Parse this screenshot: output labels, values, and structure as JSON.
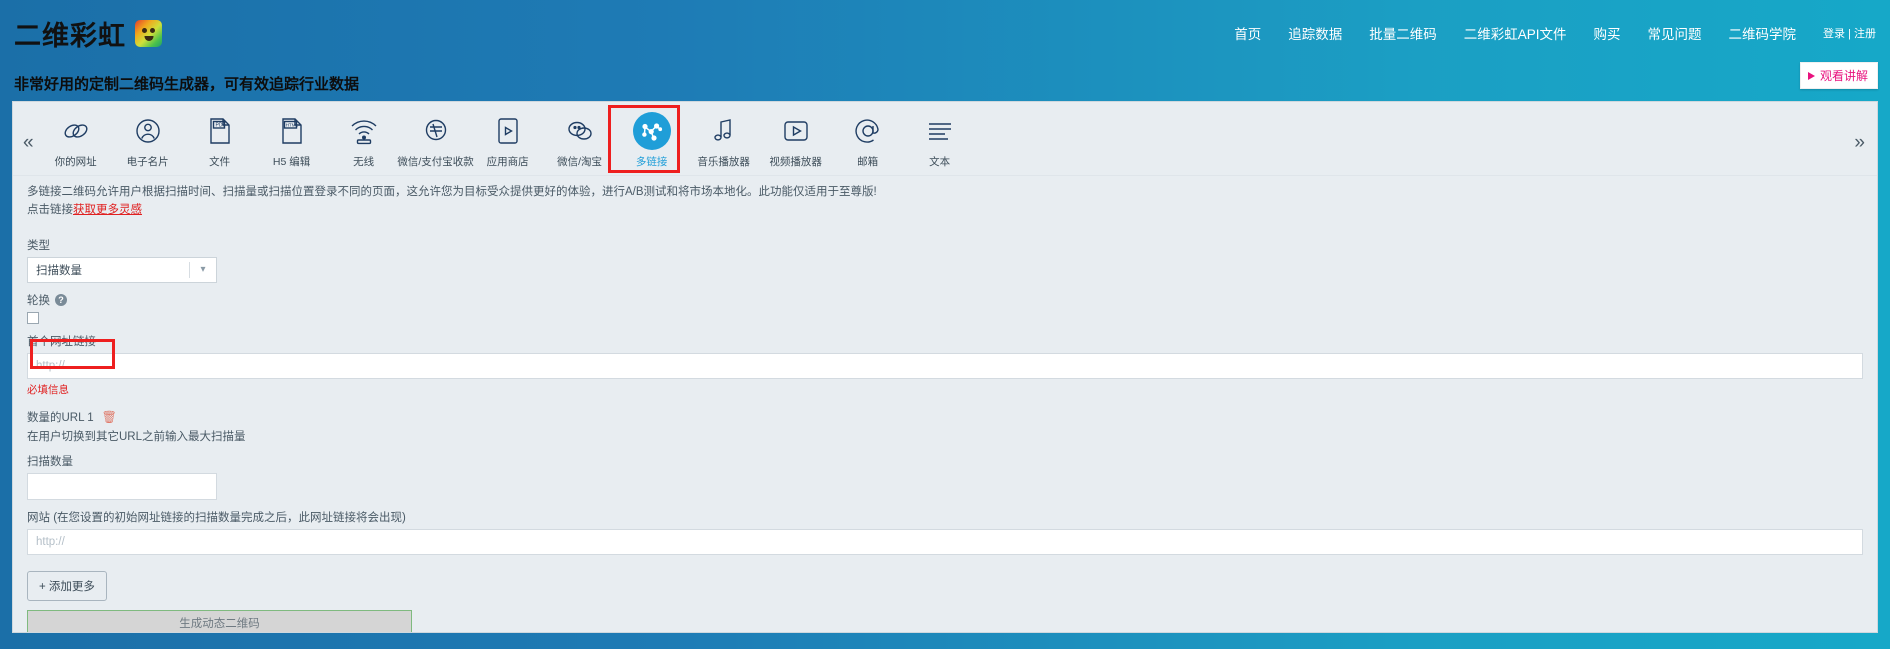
{
  "header": {
    "brand": "二维彩虹",
    "logo_icon": "rainbow-bear-logo",
    "nav": [
      {
        "label": "首页",
        "name": "nav-home"
      },
      {
        "label": "追踪数据",
        "name": "nav-tracking-data"
      },
      {
        "label": "批量二维码",
        "name": "nav-bulk-qr"
      },
      {
        "label": "二维彩虹API文件",
        "name": "nav-api-docs"
      },
      {
        "label": "购买",
        "name": "nav-purchase"
      },
      {
        "label": "常见问题",
        "name": "nav-faq"
      },
      {
        "label": "二维码学院",
        "name": "nav-academy"
      }
    ],
    "auth": "登录 | 注册",
    "watch_button": "观看讲解",
    "accent_pink": "#e8127e",
    "band_gradient_start": "#1b6fa8",
    "band_gradient_end": "#16a8c8"
  },
  "tagline": "非常好用的定制二维码生成器，可有效追踪行业数据",
  "toolbar": {
    "prev_icon": "chevron-double-left-icon",
    "next_icon": "chevron-double-right-icon",
    "active_index": 9,
    "highlight_color": "#ee1f1f",
    "active_color": "#1f9ed8",
    "items": [
      {
        "label": "你的网址",
        "icon": "link-chain-icon"
      },
      {
        "label": "电子名片",
        "icon": "user-circle-icon"
      },
      {
        "label": "文件",
        "icon": "pdf-file-icon"
      },
      {
        "label": "H5 编辑",
        "icon": "html-file-icon"
      },
      {
        "label": "无线",
        "icon": "wifi-icon"
      },
      {
        "label": "微信/支付宝收款",
        "icon": "payment-qr-icon"
      },
      {
        "label": "应用商店",
        "icon": "app-store-icon"
      },
      {
        "label": "微信/淘宝",
        "icon": "wechat-taobao-icon"
      },
      {
        "label": "多链接",
        "icon": "multi-link-network-icon"
      },
      {
        "label": "音乐播放器",
        "icon": "music-note-icon"
      },
      {
        "label": "视频播放器",
        "icon": "video-play-icon"
      },
      {
        "label": "邮箱",
        "icon": "at-sign-icon"
      },
      {
        "label": "文本",
        "icon": "text-lines-icon"
      }
    ]
  },
  "description": {
    "line1": "多链接二维码允许用户根据扫描时间、扫描量或扫描位置登录不同的页面，这允许您为目标受众提供更好的体验，进行A/B测试和将市场本地化。此功能仅适用于至尊版!",
    "line2_prefix": "点击链接",
    "line2_link": "获取更多灵感"
  },
  "form": {
    "type_label": "类型",
    "type_value": "扫描数量",
    "type_arrow_icon": "chevron-down-icon",
    "rotate_label": "轮换",
    "rotate_help_icon": "help-circle-icon",
    "rotate_checked": false,
    "first_url_label": "首个网址链接",
    "first_url_placeholder": "http://",
    "first_url_value": "",
    "first_url_error": "必填信息",
    "url_row_label": "数量的URL 1",
    "url_row_delete_icon": "trash-icon",
    "url_row_hint": "在用户切换到其它URL之前输入最大扫描量",
    "scan_count_label": "扫描数量",
    "scan_count_value": "",
    "website_label": "网站 (在您设置的初始网址链接的扫描数量完成之后，此网址链接将会出现)",
    "website_placeholder": "http://",
    "website_value": "",
    "add_more_label": "+ 添加更多",
    "generate_label": "生成动态二维码"
  }
}
